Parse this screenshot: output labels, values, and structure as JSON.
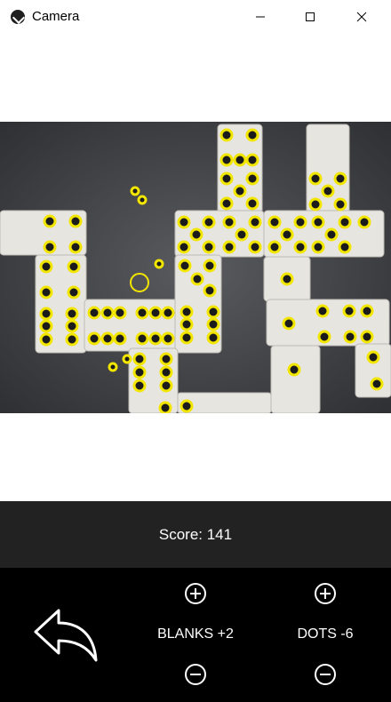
{
  "window": {
    "title": "Camera",
    "minimize_icon": "minimize-icon",
    "maximize_icon": "maximize-icon",
    "close_icon": "close-icon"
  },
  "camera": {
    "feed_icon": "camera-feed"
  },
  "score": {
    "label": "Score: 141"
  },
  "controls": {
    "back_icon": "undo-arrow-icon",
    "blanks": {
      "label": "BLANKS +2",
      "plus_icon": "plus-circle-icon",
      "minus_icon": "minus-circle-icon"
    },
    "dots": {
      "label": "DOTS -6",
      "plus_icon": "plus-circle-icon",
      "minus_icon": "minus-circle-icon"
    }
  },
  "colors": {
    "dot_highlight": "#f2e600",
    "score_bar": "#222222",
    "controls_bg": "#000000"
  }
}
